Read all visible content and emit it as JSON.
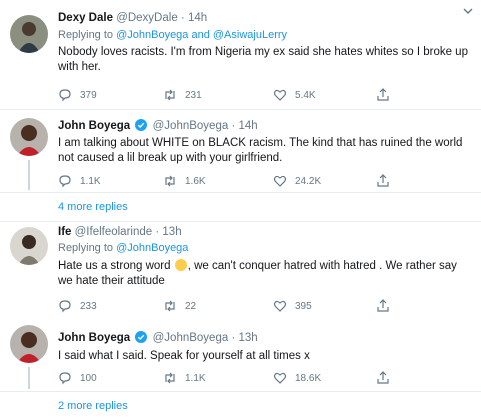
{
  "tweets": [
    {
      "name": "Dexy Dale",
      "handle": "@DexyDale",
      "sep": "·",
      "time": "14h",
      "replying_prefix": "Replying to ",
      "replying_to": "@JohnBoyega and @AsiwajuLerry",
      "text": "Nobody loves racists. I'm from Nigeria my ex said she hates whites so I broke up with her.",
      "replies": "379",
      "retweets": "231",
      "likes": "5.4K"
    },
    {
      "name": "John Boyega",
      "handle": "@JohnBoyega",
      "sep": "·",
      "time": "14h",
      "text": "I am talking about WHITE on BLACK racism. The kind that has ruined the world not caused a lil break up with your girlfriend.",
      "replies": "1.1K",
      "retweets": "1.6K",
      "likes": "24.2K"
    },
    {
      "name": "Ife",
      "handle": "@Ifelfeolarinde",
      "sep": "·",
      "time": "13h",
      "replying_prefix": "Replying to ",
      "replying_to": "@JohnBoyega",
      "text_part1": "Hate us a strong word ",
      "text_part2": ", we can't  conquer hatred with hatred . We rather say we hate their attitude",
      "replies": "233",
      "retweets": "22",
      "likes": "395"
    },
    {
      "name": "John Boyega",
      "handle": "@JohnBoyega",
      "sep": "·",
      "time": "13h",
      "text": "I said what I said. Speak for yourself at all times x",
      "replies": "100",
      "retweets": "1.1K",
      "likes": "18.6K"
    }
  ],
  "more_replies": [
    "4 more replies",
    "2 more replies"
  ],
  "colors": {
    "accent": "#1b95e0",
    "muted": "#657786",
    "text": "#14171a",
    "border": "#e6ecf0"
  },
  "icons": {
    "reply": "reply-icon",
    "retweet": "retweet-icon",
    "like": "heart-icon",
    "share": "share-icon",
    "verified": "verified-badge-icon",
    "caret": "chevron-down-icon"
  }
}
